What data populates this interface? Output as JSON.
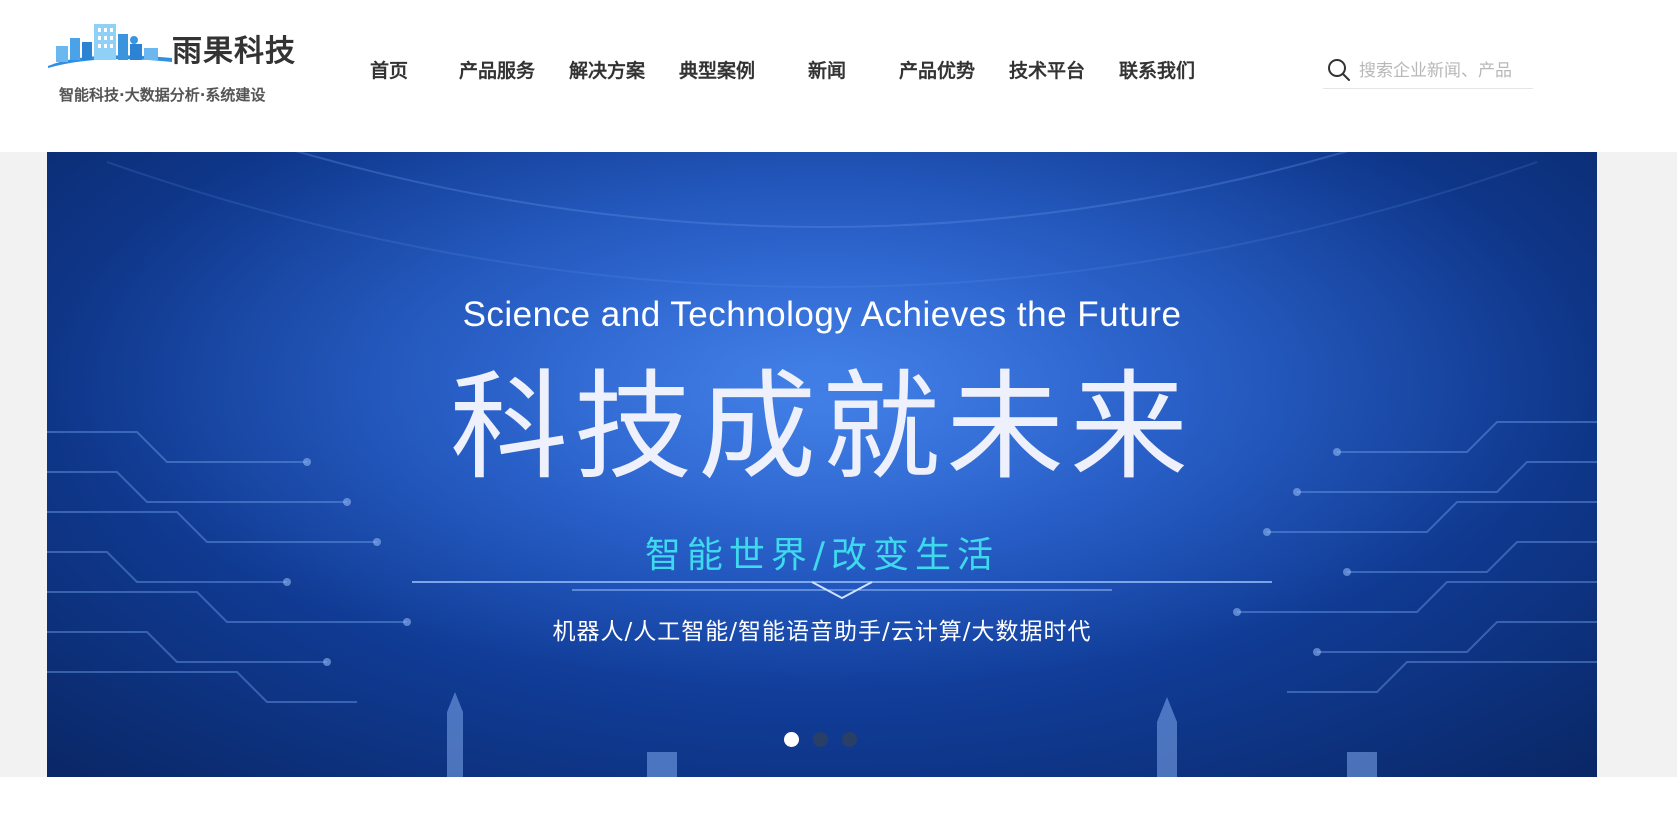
{
  "brand": {
    "name": "雨果科技",
    "tagline": "智能科技·大数据分析·系统建设"
  },
  "nav": {
    "items": [
      "首页",
      "产品服务",
      "解决方案",
      "典型案例",
      "新闻",
      "产品优势",
      "技术平台",
      "联系我们"
    ]
  },
  "search": {
    "placeholder": "搜索企业新闻、产品",
    "value": ""
  },
  "banner": {
    "subtitle_en": "Science and Technology Achieves the Future",
    "title": "科技成就未来",
    "slogan": "智能世界/改变生活",
    "keywords": "机器人/人工智能/智能语音助手/云计算/大数据时代",
    "slides_count": 3,
    "active_slide": 1
  },
  "colors": {
    "text_dark": "#333333",
    "banner_blue": "#1a4eb8",
    "slogan_cyan": "#3fd9ee",
    "logo_blue": "#2f8fe0"
  }
}
